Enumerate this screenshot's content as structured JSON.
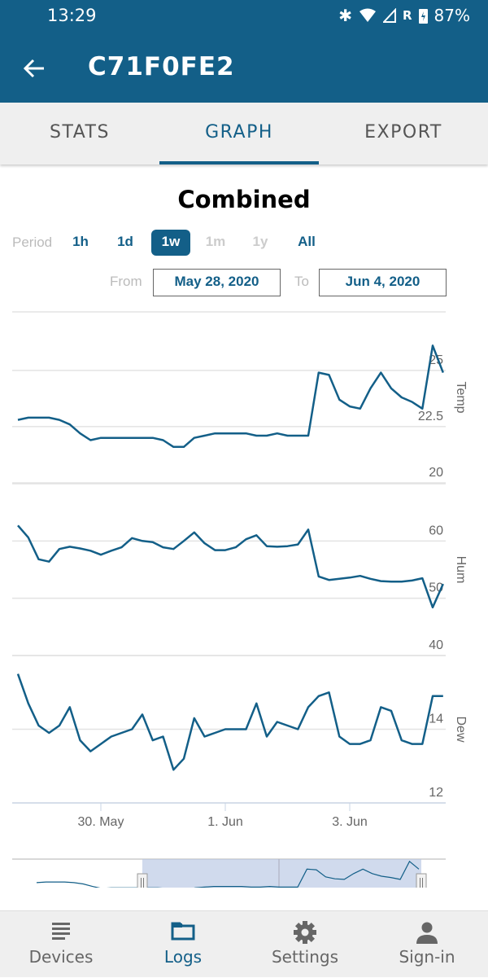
{
  "status_bar": {
    "time": "13:29",
    "battery": "87%",
    "icons": [
      "bluetooth-icon",
      "wifi-icon",
      "signal-icon",
      "roaming-r",
      "battery-charging-icon"
    ],
    "roaming": "R"
  },
  "app_bar": {
    "title": "C71F0FE2",
    "back_icon": "arrow-left-icon"
  },
  "tabs": [
    {
      "label": "STATS",
      "active": false
    },
    {
      "label": "GRAPH",
      "active": true
    },
    {
      "label": "EXPORT",
      "active": false
    }
  ],
  "graph": {
    "title": "Combined",
    "period_label": "Period",
    "periods": [
      {
        "label": "1h",
        "state": "enabled"
      },
      {
        "label": "1d",
        "state": "enabled"
      },
      {
        "label": "1w",
        "state": "selected"
      },
      {
        "label": "1m",
        "state": "disabled"
      },
      {
        "label": "1y",
        "state": "disabled"
      },
      {
        "label": "All",
        "state": "enabled"
      }
    ],
    "from_label": "From",
    "from_value": "May 28, 2020",
    "to_label": "To",
    "to_value": "Jun 4, 2020",
    "navigator_label": "1. Jun"
  },
  "chart_data": {
    "type": "line",
    "line_color": "#135f88",
    "x_ticks": [
      "30. May",
      "1. Jun",
      "3. Jun"
    ],
    "x": [
      "2020-05-28 16:00",
      "2020-05-28 20:00",
      "2020-05-29 00:00",
      "2020-05-29 04:00",
      "2020-05-29 08:00",
      "2020-05-29 12:00",
      "2020-05-29 16:00",
      "2020-05-29 20:00",
      "2020-05-30 00:00",
      "2020-05-30 04:00",
      "2020-05-30 08:00",
      "2020-05-30 12:00",
      "2020-05-30 16:00",
      "2020-05-30 20:00",
      "2020-05-31 00:00",
      "2020-05-31 04:00",
      "2020-05-31 08:00",
      "2020-05-31 12:00",
      "2020-05-31 16:00",
      "2020-05-31 20:00",
      "2020-06-01 00:00",
      "2020-06-01 04:00",
      "2020-06-01 08:00",
      "2020-06-01 12:00",
      "2020-06-01 16:00",
      "2020-06-01 20:00",
      "2020-06-02 00:00",
      "2020-06-02 04:00",
      "2020-06-02 08:00",
      "2020-06-02 12:00",
      "2020-06-02 16:00",
      "2020-06-02 20:00",
      "2020-06-03 00:00",
      "2020-06-03 04:00",
      "2020-06-03 08:00",
      "2020-06-03 12:00",
      "2020-06-03 16:00",
      "2020-06-03 20:00",
      "2020-06-04 00:00",
      "2020-06-04 04:00",
      "2020-06-04 08:00",
      "2020-06-04 12:00"
    ],
    "series": [
      {
        "name": "Temp",
        "ylim": [
          20,
          27.6
        ],
        "ticks": [
          "20",
          "22.5",
          "25"
        ],
        "tick_values": [
          20,
          22.5,
          25
        ],
        "values": [
          22.8,
          22.9,
          22.9,
          22.9,
          22.8,
          22.6,
          22.2,
          21.9,
          22.0,
          22.0,
          22.0,
          22.0,
          22.0,
          22.0,
          21.9,
          21.6,
          21.6,
          22.0,
          22.1,
          22.2,
          22.2,
          22.2,
          22.2,
          22.1,
          22.1,
          22.2,
          22.1,
          22.1,
          22.1,
          24.9,
          24.8,
          23.7,
          23.4,
          23.3,
          24.2,
          24.9,
          24.2,
          23.8,
          23.6,
          23.3,
          26.1,
          24.9
        ]
      },
      {
        "name": "Hum",
        "ylim": [
          40,
          70
        ],
        "ticks": [
          "40",
          "50",
          "60"
        ],
        "tick_values": [
          40,
          50,
          60
        ],
        "values": [
          62.7,
          60.6,
          56.8,
          56.4,
          58.6,
          59.0,
          58.7,
          58.3,
          57.6,
          58.3,
          58.9,
          60.5,
          60.0,
          59.8,
          58.9,
          58.6,
          60.0,
          61.5,
          59.6,
          58.4,
          58.4,
          58.9,
          60.3,
          61.0,
          59.1,
          59.0,
          59.1,
          59.4,
          62.0,
          53.8,
          53.2,
          53.4,
          53.6,
          53.9,
          53.4,
          53.0,
          52.9,
          52.9,
          53.1,
          53.5,
          48.4,
          52.5
        ]
      },
      {
        "name": "Dew",
        "ylim": [
          12,
          16
        ],
        "ticks": [
          "12",
          "14"
        ],
        "tick_values": [
          12,
          14
        ],
        "values": [
          15.5,
          14.7,
          14.1,
          13.9,
          14.1,
          14.6,
          13.7,
          13.4,
          13.6,
          13.8,
          13.9,
          14.0,
          14.4,
          13.7,
          13.8,
          12.9,
          13.2,
          14.3,
          13.8,
          13.9,
          14.0,
          14.0,
          14.0,
          14.7,
          13.8,
          14.2,
          14.1,
          14.0,
          14.6,
          14.9,
          15.0,
          13.8,
          13.6,
          13.6,
          13.7,
          14.6,
          14.5,
          13.7,
          13.6,
          13.6,
          14.9,
          14.9
        ]
      }
    ],
    "grid": true
  },
  "bottom_nav": [
    {
      "label": "Devices",
      "icon": "list-icon",
      "active": false
    },
    {
      "label": "Logs",
      "icon": "folder-icon",
      "active": true
    },
    {
      "label": "Settings",
      "icon": "gear-icon",
      "active": false
    },
    {
      "label": "Sign-in",
      "icon": "person-icon",
      "active": false
    }
  ]
}
